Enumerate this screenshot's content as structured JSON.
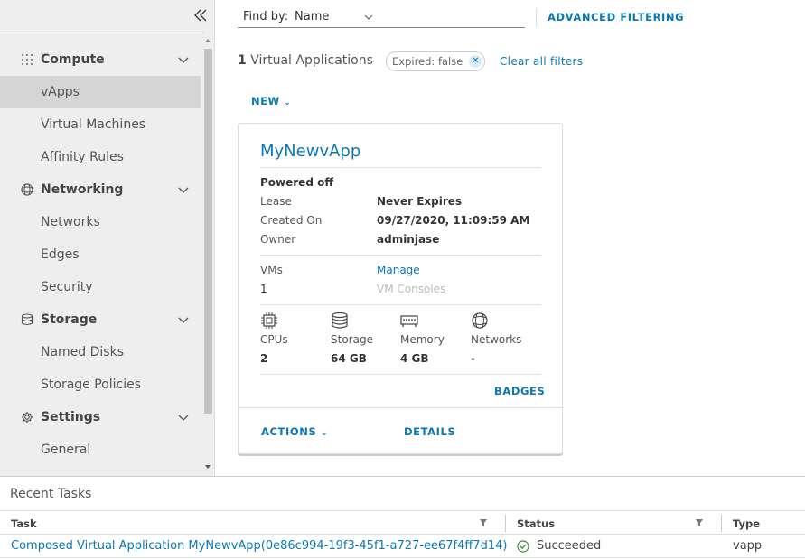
{
  "sidebar": {
    "groups": [
      {
        "label": "Compute",
        "icon": "grid-icon",
        "items": [
          "vApps",
          "Virtual Machines",
          "Affinity Rules"
        ]
      },
      {
        "label": "Networking",
        "icon": "network-globe-icon",
        "items": [
          "Networks",
          "Edges",
          "Security"
        ]
      },
      {
        "label": "Storage",
        "icon": "database-icon",
        "items": [
          "Named Disks",
          "Storage Policies"
        ]
      },
      {
        "label": "Settings",
        "icon": "gear-icon",
        "items": [
          "General"
        ]
      }
    ],
    "active_item": "vApps"
  },
  "toolbar": {
    "find_by_label": "Find by:",
    "find_by_value": "Name",
    "advanced_filtering": "ADVANCED FILTERING"
  },
  "summary": {
    "count": "1",
    "count_label": "Virtual Applications",
    "filter_chip": "Expired: false",
    "clear_filters": "Clear all filters"
  },
  "new_button": "NEW",
  "card": {
    "title": "MyNewvApp",
    "power_state": "Powered off",
    "lease_label": "Lease",
    "lease_value": "Never Expires",
    "created_label": "Created On",
    "created_value": "09/27/2020, 11:09:59 AM",
    "owner_label": "Owner",
    "owner_value": "adminjase",
    "vms_label": "VMs",
    "vms_value": "1",
    "manage_link": "Manage",
    "vm_consoles": "VM Consoles",
    "resources": [
      {
        "label": "CPUs",
        "value": "2",
        "icon": "cpu-icon"
      },
      {
        "label": "Storage",
        "value": "64 GB",
        "icon": "database-icon"
      },
      {
        "label": "Memory",
        "value": "4 GB",
        "icon": "memory-icon"
      },
      {
        "label": "Networks",
        "value": "-",
        "icon": "network-globe-icon"
      }
    ],
    "badges": "BADGES",
    "actions": "ACTIONS",
    "details": "DETAILS"
  },
  "recent_tasks": {
    "title": "Recent Tasks",
    "columns": [
      "Task",
      "Status",
      "Type"
    ],
    "rows": [
      {
        "task": "Composed Virtual Application MyNewvApp(0e86c994-19f3-45f1-a727-ee67f4ff7d14)",
        "status": "Succeeded",
        "type": "vapp"
      }
    ]
  },
  "colors": {
    "accent": "#0b77b3",
    "sidebar_bg": "#eeeeee",
    "active_item_bg": "#d5d5d5",
    "success": "#3c8c3c"
  }
}
